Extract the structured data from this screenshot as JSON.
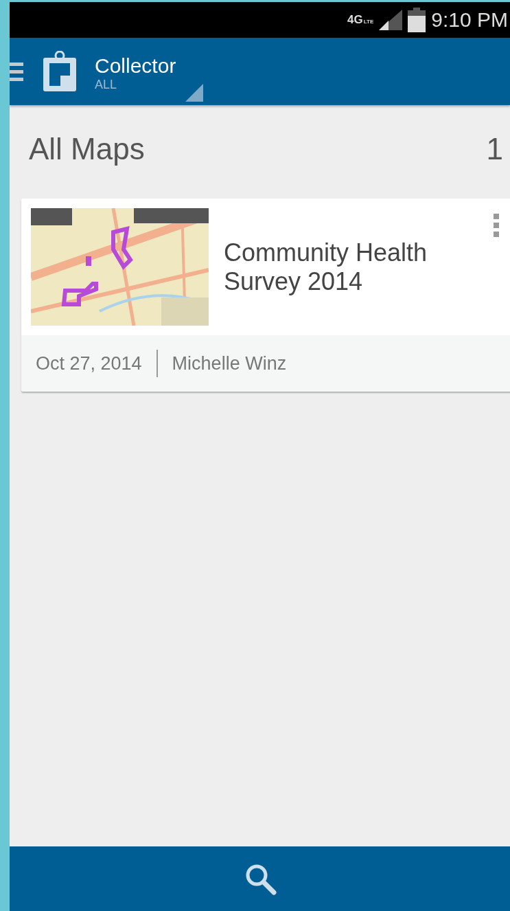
{
  "status_bar": {
    "network": "4G",
    "network_sub": "LTE",
    "time": "9:10 PM"
  },
  "app_bar": {
    "title": "Collector",
    "filter": "ALL"
  },
  "list": {
    "title": "All Maps",
    "count": "1"
  },
  "maps": [
    {
      "title": "Community Health Survey 2014",
      "date": "Oct 27, 2014",
      "owner": "Michelle Winz"
    }
  ]
}
